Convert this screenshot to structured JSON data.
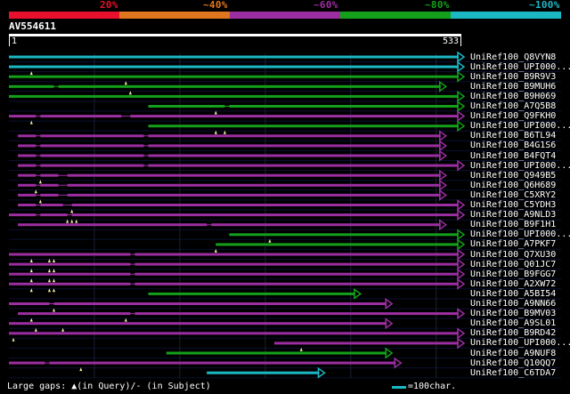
{
  "legend": {
    "labels": [
      "20%",
      "~40%",
      "~60%",
      "~80%",
      "~100%"
    ],
    "colors": [
      "#e8102c",
      "#e0761e",
      "#9b2ea0",
      "#14a01a",
      "#1bb8c4"
    ]
  },
  "query": {
    "title": "AV554611",
    "start": "1",
    "end": "533"
  },
  "hits": [
    {
      "name": "UniRef100_Q8VYN8",
      "color": "#1bb8c4",
      "start": 0.0,
      "end": 1.0,
      "segs": [
        [
          0,
          1
        ]
      ],
      "gaps": []
    },
    {
      "name": "UniRef100_UPI000...",
      "color": "#1bb8c4",
      "start": 0.0,
      "end": 1.0,
      "segs": [
        [
          0,
          1
        ]
      ],
      "gaps": [
        0.05
      ]
    },
    {
      "name": "UniRef100_B9R9V3",
      "color": "#14a01a",
      "start": 0.0,
      "end": 1.0,
      "segs": [
        [
          0,
          1
        ]
      ],
      "gaps": [
        0.26
      ]
    },
    {
      "name": "UniRef100_B9MUH6",
      "color": "#14a01a",
      "start": 0.0,
      "end": 0.96,
      "segs": [
        [
          0,
          0.1
        ],
        [
          0.11,
          0.96
        ]
      ],
      "gaps": [
        0.27
      ]
    },
    {
      "name": "UniRef100_B9H069",
      "color": "#14a01a",
      "start": 0.0,
      "end": 1.0,
      "segs": [
        [
          0,
          1
        ]
      ],
      "gaps": []
    },
    {
      "name": "UniRef100_A7Q5B8",
      "color": "#14a01a",
      "start": 0.31,
      "end": 1.0,
      "segs": [
        [
          0.31,
          0.48
        ],
        [
          0.49,
          1.0
        ]
      ],
      "gaps": [
        0.46
      ]
    },
    {
      "name": "UniRef100_Q9FKH0",
      "color": "#9b2ea0",
      "start": 0.0,
      "end": 1.0,
      "segs": [
        [
          0,
          0.06
        ],
        [
          0.07,
          0.25
        ],
        [
          0.27,
          1.0
        ]
      ],
      "gaps": [
        0.05
      ]
    },
    {
      "name": "UniRef100_UPI000...",
      "color": "#14a01a",
      "start": 0.31,
      "end": 1.0,
      "segs": [
        [
          0.31,
          1.0
        ]
      ],
      "gaps": [
        0.46,
        0.48
      ]
    },
    {
      "name": "UniRef100_B6TL94",
      "color": "#9b2ea0",
      "start": 0.02,
      "end": 0.96,
      "segs": [
        [
          0.02,
          0.06
        ],
        [
          0.07,
          0.3
        ],
        [
          0.31,
          0.96
        ]
      ],
      "gaps": []
    },
    {
      "name": "UniRef100_B4G1S6",
      "color": "#9b2ea0",
      "start": 0.02,
      "end": 0.96,
      "segs": [
        [
          0.02,
          0.06
        ],
        [
          0.07,
          0.3
        ],
        [
          0.31,
          0.96
        ]
      ],
      "gaps": []
    },
    {
      "name": "UniRef100_B4FQT4",
      "color": "#9b2ea0",
      "start": 0.02,
      "end": 0.96,
      "segs": [
        [
          0.02,
          0.06
        ],
        [
          0.07,
          0.3
        ],
        [
          0.31,
          0.96
        ]
      ],
      "gaps": []
    },
    {
      "name": "UniRef100_UPI000...",
      "color": "#9b2ea0",
      "start": 0.02,
      "end": 1.0,
      "segs": [
        [
          0.02,
          0.06
        ],
        [
          0.07,
          0.3
        ],
        [
          0.31,
          1.0
        ]
      ],
      "gaps": []
    },
    {
      "name": "UniRef100_Q949B5",
      "color": "#9b2ea0",
      "start": 0.02,
      "end": 0.96,
      "segs": [
        [
          0.02,
          0.06
        ],
        [
          0.07,
          0.11
        ],
        [
          0.13,
          0.96
        ]
      ],
      "gaps": [
        0.07
      ]
    },
    {
      "name": "UniRef100_Q6H689",
      "color": "#9b2ea0",
      "start": 0.02,
      "end": 0.96,
      "segs": [
        [
          0.02,
          0.06
        ],
        [
          0.07,
          0.11
        ],
        [
          0.13,
          0.96
        ]
      ],
      "gaps": [
        0.06
      ]
    },
    {
      "name": "UniRef100_C5XRY2",
      "color": "#9b2ea0",
      "start": 0.02,
      "end": 0.96,
      "segs": [
        [
          0.02,
          0.06
        ],
        [
          0.07,
          0.11
        ],
        [
          0.13,
          0.96
        ]
      ],
      "gaps": [
        0.07
      ]
    },
    {
      "name": "UniRef100_C5YDH3",
      "color": "#9b2ea0",
      "start": 0.02,
      "end": 1.0,
      "segs": [
        [
          0.02,
          0.06
        ],
        [
          0.07,
          0.12
        ],
        [
          0.14,
          1.0
        ]
      ],
      "gaps": [
        0.14
      ]
    },
    {
      "name": "UniRef100_A9NLD3",
      "color": "#9b2ea0",
      "start": 0.0,
      "end": 1.0,
      "segs": [
        [
          0,
          0.06
        ],
        [
          0.07,
          0.13
        ],
        [
          0.14,
          1.0
        ]
      ],
      "gaps": [
        0.13,
        0.14,
        0.15
      ]
    },
    {
      "name": "UniRef100_B9F1H1",
      "color": "#9b2ea0",
      "start": 0.02,
      "end": 0.96,
      "segs": [
        [
          0.02,
          0.44
        ],
        [
          0.45,
          0.96
        ]
      ],
      "gaps": []
    },
    {
      "name": "UniRef100_UPI000...",
      "color": "#14a01a",
      "start": 0.49,
      "end": 1.0,
      "segs": [
        [
          0.49,
          1.0
        ]
      ],
      "gaps": [
        0.58
      ]
    },
    {
      "name": "UniRef100_A7PKF7",
      "color": "#14a01a",
      "start": 0.46,
      "end": 1.0,
      "segs": [
        [
          0.46,
          1.0
        ]
      ],
      "gaps": [
        0.46
      ]
    },
    {
      "name": "UniRef100_Q7XU30",
      "color": "#9b2ea0",
      "start": 0.0,
      "end": 1.0,
      "segs": [
        [
          0,
          0.27
        ],
        [
          0.28,
          1.0
        ]
      ],
      "gaps": [
        0.05,
        0.09,
        0.1
      ]
    },
    {
      "name": "UniRef100_Q01JC7",
      "color": "#9b2ea0",
      "start": 0.0,
      "end": 1.0,
      "segs": [
        [
          0,
          0.27
        ],
        [
          0.28,
          1.0
        ]
      ],
      "gaps": [
        0.05,
        0.09,
        0.1
      ]
    },
    {
      "name": "UniRef100_B9FGG7",
      "color": "#9b2ea0",
      "start": 0.0,
      "end": 1.0,
      "segs": [
        [
          0,
          0.27
        ],
        [
          0.28,
          1.0
        ]
      ],
      "gaps": [
        0.05,
        0.09,
        0.1
      ]
    },
    {
      "name": "UniRef100_A2XW72",
      "color": "#9b2ea0",
      "start": 0.0,
      "end": 1.0,
      "segs": [
        [
          0,
          0.27
        ],
        [
          0.28,
          1.0
        ]
      ],
      "gaps": [
        0.05,
        0.09,
        0.1
      ]
    },
    {
      "name": "UniRef100_A5BI54",
      "color": "#14a01a",
      "start": 0.31,
      "end": 0.77,
      "segs": [
        [
          0.31,
          0.77
        ]
      ],
      "gaps": []
    },
    {
      "name": "UniRef100_A9NN66",
      "color": "#9b2ea0",
      "start": 0.0,
      "end": 0.84,
      "segs": [
        [
          0,
          0.09
        ],
        [
          0.1,
          0.84
        ]
      ],
      "gaps": [
        0.1
      ]
    },
    {
      "name": "UniRef100_B9MV03",
      "color": "#9b2ea0",
      "start": 0.02,
      "end": 1.0,
      "segs": [
        [
          0.02,
          0.27
        ],
        [
          0.28,
          1.0
        ]
      ],
      "gaps": [
        0.05,
        0.26
      ]
    },
    {
      "name": "UniRef100_A9SL01",
      "color": "#9b2ea0",
      "start": 0.0,
      "end": 0.84,
      "segs": [
        [
          0,
          0.84
        ]
      ],
      "gaps": [
        0.06,
        0.12
      ]
    },
    {
      "name": "UniRef100_B9RD42",
      "color": "#9b2ea0",
      "start": 0.0,
      "end": 1.0,
      "segs": [
        [
          0,
          1.0
        ]
      ],
      "gaps": [
        0.01
      ]
    },
    {
      "name": "UniRef100_UPI000...",
      "color": "#9b2ea0",
      "start": 0.59,
      "end": 1.0,
      "segs": [
        [
          0.59,
          1.0
        ]
      ],
      "gaps": [
        0.65
      ]
    },
    {
      "name": "UniRef100_A9NUF8",
      "color": "#14a01a",
      "start": 0.35,
      "end": 0.84,
      "segs": [
        [
          0.35,
          0.84
        ]
      ],
      "gaps": []
    },
    {
      "name": "UniRef100_Q10QQ7",
      "color": "#9b2ea0",
      "start": 0.0,
      "end": 0.86,
      "segs": [
        [
          0,
          0.08
        ],
        [
          0.09,
          0.86
        ]
      ],
      "gaps": [
        0.16
      ]
    },
    {
      "name": "UniRef100_C6TDA7",
      "color": "#1bb8c4",
      "start": 0.44,
      "end": 0.69,
      "segs": [
        [
          0.44,
          0.69
        ]
      ],
      "gaps": []
    }
  ],
  "footer": {
    "gaps_text": "Large gaps: ▲(in Query)/- (in Subject)",
    "scale_text": "=100char."
  }
}
